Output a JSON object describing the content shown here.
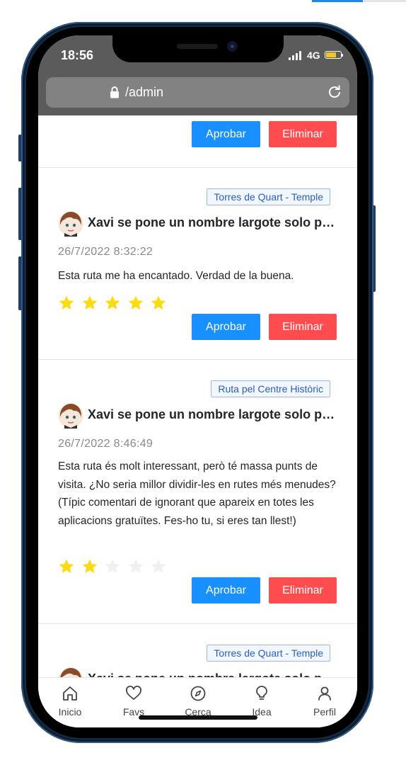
{
  "status": {
    "time": "18:56",
    "network": "4G"
  },
  "browser": {
    "url": "/admin"
  },
  "actions": {
    "approve": "Aprobar",
    "delete": "Eliminar"
  },
  "reviews": [
    {
      "route": "Torres de Quart - Temple",
      "author": "Xavi se pone un nombre largote solo para fastidiar",
      "date": "26/7/2022 8:32:22",
      "text": "Esta ruta me ha encantado. Verdad de la buena.",
      "rating": 5
    },
    {
      "route": "Ruta pel Centre Històric",
      "author": "Xavi se pone un nombre largote solo para fastidiar",
      "date": "26/7/2022 8:46:49",
      "text": "Esta ruta és molt interessant, però té massa punts de visita. ¿No seria millor dividir-les en rutes més menudes? (Típic comentari de ignorant que apareix en totes les aplicacions gratuïtes. Fes-ho tu, si eres tan llest!)",
      "rating": 2
    },
    {
      "route": "Torres de Quart - Temple",
      "author": "Xavi se pone un nombre largote solo para fastidiar"
    }
  ],
  "tabbar": [
    {
      "label": "Inicio",
      "icon": "home-icon"
    },
    {
      "label": "Favs",
      "icon": "heart-icon"
    },
    {
      "label": "Cerca",
      "icon": "compass-icon"
    },
    {
      "label": "Idea",
      "icon": "lightbulb-icon"
    },
    {
      "label": "Perfil",
      "icon": "user-icon"
    }
  ],
  "colors": {
    "approve": "#1890ff",
    "delete": "#ff4d4f",
    "star_filled": "#fadb14",
    "star_empty": "#f0f0f0"
  }
}
